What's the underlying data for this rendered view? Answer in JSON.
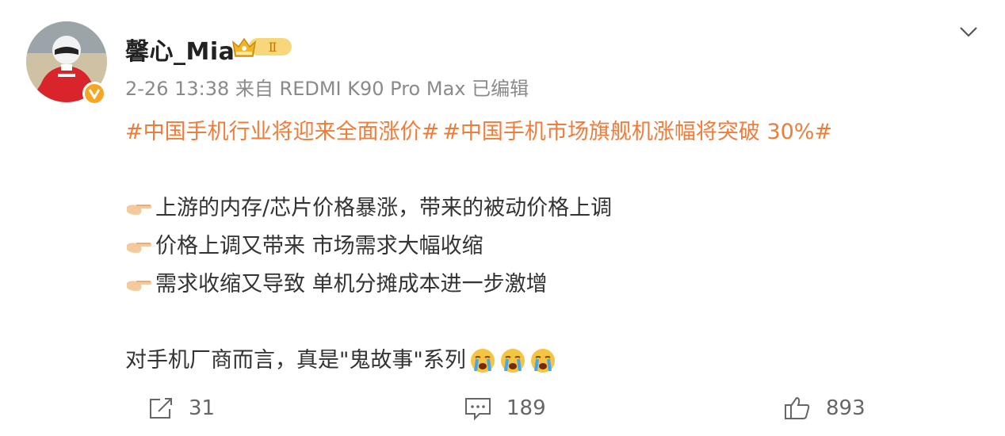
{
  "post": {
    "username": "馨心_Mia",
    "level_badge": "Ⅱ",
    "meta": "2-26 13:38 来自 REDMI K90 Pro Max 已编辑",
    "hashtags": [
      "#中国手机行业将迎来全面涨价#",
      "#中国手机市场旗舰机涨幅将突破 30%#"
    ],
    "points": [
      "上游的内存/芯片价格暴涨，带来的被动价格上调",
      "价格上调又带来 市场需求大幅收缩",
      "需求收缩又导致 单机分摊成本进一步激增"
    ],
    "closing": "对手机厂商而言，真是\"鬼故事\"系列",
    "colors": {
      "accent": "#ee7d3b",
      "meta": "#8a8a8a",
      "text": "#333333",
      "verified": "#f5a623"
    },
    "icons": [
      "avatar",
      "verified-badge-icon",
      "crown-level-icon",
      "chevron-down-icon",
      "pointing-hand-icon",
      "crying-face-icon",
      "share-icon",
      "comment-icon",
      "like-icon"
    ]
  },
  "footer": {
    "share_count": "31",
    "comment_count": "189",
    "like_count": "893"
  }
}
